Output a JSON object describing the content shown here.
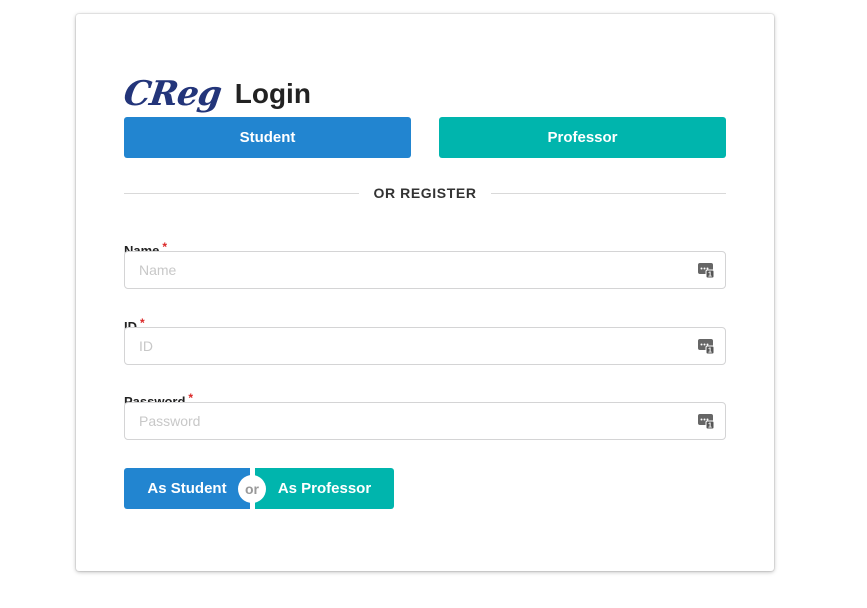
{
  "header": {
    "logo_text": "CReg",
    "title": "Login"
  },
  "login_buttons": {
    "student": "Student",
    "professor": "Professor"
  },
  "divider_text": "OR REGISTER",
  "form": {
    "required_marker": "*",
    "name": {
      "label": "Name",
      "placeholder": "Name",
      "value": ""
    },
    "id": {
      "label": "ID",
      "placeholder": "ID",
      "value": ""
    },
    "password": {
      "label": "Password",
      "placeholder": "Password",
      "value": ""
    },
    "field_icon": "password-manager-icon"
  },
  "register_buttons": {
    "as_student": "As Student",
    "or": "or",
    "as_professor": "As Professor"
  },
  "colors": {
    "primary_blue": "#2285d0",
    "teal": "#00b5ad",
    "logo_navy": "#23357a",
    "required_red": "#db2828"
  }
}
